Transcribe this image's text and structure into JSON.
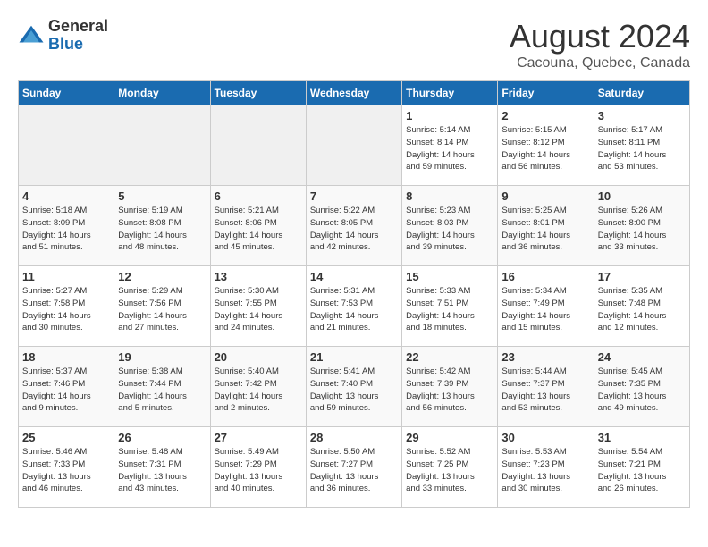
{
  "logo": {
    "general": "General",
    "blue": "Blue"
  },
  "title": {
    "month_year": "August 2024",
    "location": "Cacouna, Quebec, Canada"
  },
  "days_of_week": [
    "Sunday",
    "Monday",
    "Tuesday",
    "Wednesday",
    "Thursday",
    "Friday",
    "Saturday"
  ],
  "weeks": [
    [
      {
        "day": "",
        "info": ""
      },
      {
        "day": "",
        "info": ""
      },
      {
        "day": "",
        "info": ""
      },
      {
        "day": "",
        "info": ""
      },
      {
        "day": "1",
        "info": "Sunrise: 5:14 AM\nSunset: 8:14 PM\nDaylight: 14 hours\nand 59 minutes."
      },
      {
        "day": "2",
        "info": "Sunrise: 5:15 AM\nSunset: 8:12 PM\nDaylight: 14 hours\nand 56 minutes."
      },
      {
        "day": "3",
        "info": "Sunrise: 5:17 AM\nSunset: 8:11 PM\nDaylight: 14 hours\nand 53 minutes."
      }
    ],
    [
      {
        "day": "4",
        "info": "Sunrise: 5:18 AM\nSunset: 8:09 PM\nDaylight: 14 hours\nand 51 minutes."
      },
      {
        "day": "5",
        "info": "Sunrise: 5:19 AM\nSunset: 8:08 PM\nDaylight: 14 hours\nand 48 minutes."
      },
      {
        "day": "6",
        "info": "Sunrise: 5:21 AM\nSunset: 8:06 PM\nDaylight: 14 hours\nand 45 minutes."
      },
      {
        "day": "7",
        "info": "Sunrise: 5:22 AM\nSunset: 8:05 PM\nDaylight: 14 hours\nand 42 minutes."
      },
      {
        "day": "8",
        "info": "Sunrise: 5:23 AM\nSunset: 8:03 PM\nDaylight: 14 hours\nand 39 minutes."
      },
      {
        "day": "9",
        "info": "Sunrise: 5:25 AM\nSunset: 8:01 PM\nDaylight: 14 hours\nand 36 minutes."
      },
      {
        "day": "10",
        "info": "Sunrise: 5:26 AM\nSunset: 8:00 PM\nDaylight: 14 hours\nand 33 minutes."
      }
    ],
    [
      {
        "day": "11",
        "info": "Sunrise: 5:27 AM\nSunset: 7:58 PM\nDaylight: 14 hours\nand 30 minutes."
      },
      {
        "day": "12",
        "info": "Sunrise: 5:29 AM\nSunset: 7:56 PM\nDaylight: 14 hours\nand 27 minutes."
      },
      {
        "day": "13",
        "info": "Sunrise: 5:30 AM\nSunset: 7:55 PM\nDaylight: 14 hours\nand 24 minutes."
      },
      {
        "day": "14",
        "info": "Sunrise: 5:31 AM\nSunset: 7:53 PM\nDaylight: 14 hours\nand 21 minutes."
      },
      {
        "day": "15",
        "info": "Sunrise: 5:33 AM\nSunset: 7:51 PM\nDaylight: 14 hours\nand 18 minutes."
      },
      {
        "day": "16",
        "info": "Sunrise: 5:34 AM\nSunset: 7:49 PM\nDaylight: 14 hours\nand 15 minutes."
      },
      {
        "day": "17",
        "info": "Sunrise: 5:35 AM\nSunset: 7:48 PM\nDaylight: 14 hours\nand 12 minutes."
      }
    ],
    [
      {
        "day": "18",
        "info": "Sunrise: 5:37 AM\nSunset: 7:46 PM\nDaylight: 14 hours\nand 9 minutes."
      },
      {
        "day": "19",
        "info": "Sunrise: 5:38 AM\nSunset: 7:44 PM\nDaylight: 14 hours\nand 5 minutes."
      },
      {
        "day": "20",
        "info": "Sunrise: 5:40 AM\nSunset: 7:42 PM\nDaylight: 14 hours\nand 2 minutes."
      },
      {
        "day": "21",
        "info": "Sunrise: 5:41 AM\nSunset: 7:40 PM\nDaylight: 13 hours\nand 59 minutes."
      },
      {
        "day": "22",
        "info": "Sunrise: 5:42 AM\nSunset: 7:39 PM\nDaylight: 13 hours\nand 56 minutes."
      },
      {
        "day": "23",
        "info": "Sunrise: 5:44 AM\nSunset: 7:37 PM\nDaylight: 13 hours\nand 53 minutes."
      },
      {
        "day": "24",
        "info": "Sunrise: 5:45 AM\nSunset: 7:35 PM\nDaylight: 13 hours\nand 49 minutes."
      }
    ],
    [
      {
        "day": "25",
        "info": "Sunrise: 5:46 AM\nSunset: 7:33 PM\nDaylight: 13 hours\nand 46 minutes."
      },
      {
        "day": "26",
        "info": "Sunrise: 5:48 AM\nSunset: 7:31 PM\nDaylight: 13 hours\nand 43 minutes."
      },
      {
        "day": "27",
        "info": "Sunrise: 5:49 AM\nSunset: 7:29 PM\nDaylight: 13 hours\nand 40 minutes."
      },
      {
        "day": "28",
        "info": "Sunrise: 5:50 AM\nSunset: 7:27 PM\nDaylight: 13 hours\nand 36 minutes."
      },
      {
        "day": "29",
        "info": "Sunrise: 5:52 AM\nSunset: 7:25 PM\nDaylight: 13 hours\nand 33 minutes."
      },
      {
        "day": "30",
        "info": "Sunrise: 5:53 AM\nSunset: 7:23 PM\nDaylight: 13 hours\nand 30 minutes."
      },
      {
        "day": "31",
        "info": "Sunrise: 5:54 AM\nSunset: 7:21 PM\nDaylight: 13 hours\nand 26 minutes."
      }
    ]
  ]
}
